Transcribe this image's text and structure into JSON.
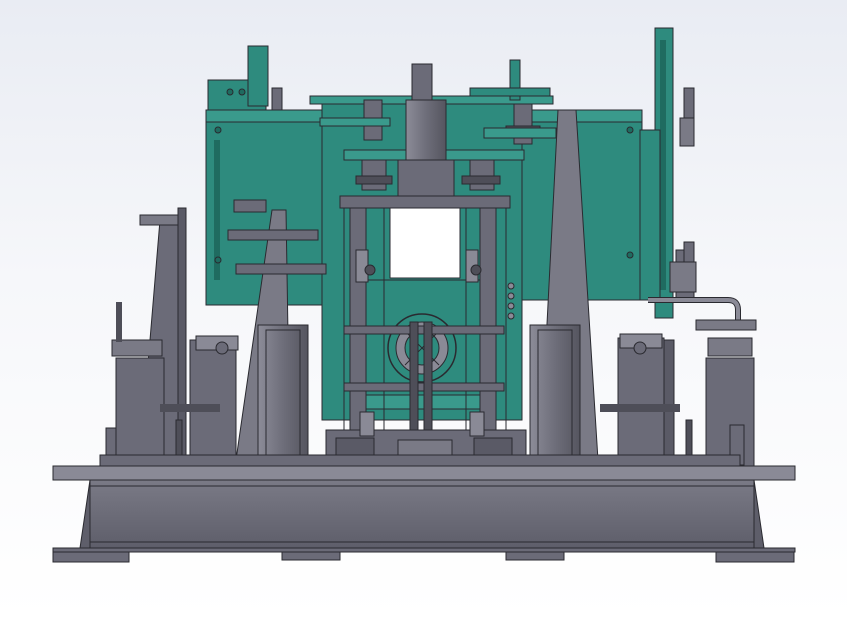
{
  "viewport": {
    "background_top": "#e9ecf3",
    "background_bottom": "#ffffff"
  },
  "model": {
    "teal": "#2e8b7e",
    "teal_dark": "#1f6b60",
    "steel": "#6b6b78",
    "steel_light": "#8a8a96",
    "steel_dark": "#4e4e58",
    "edge": "#2a2a30",
    "glass": "#ffffff"
  }
}
